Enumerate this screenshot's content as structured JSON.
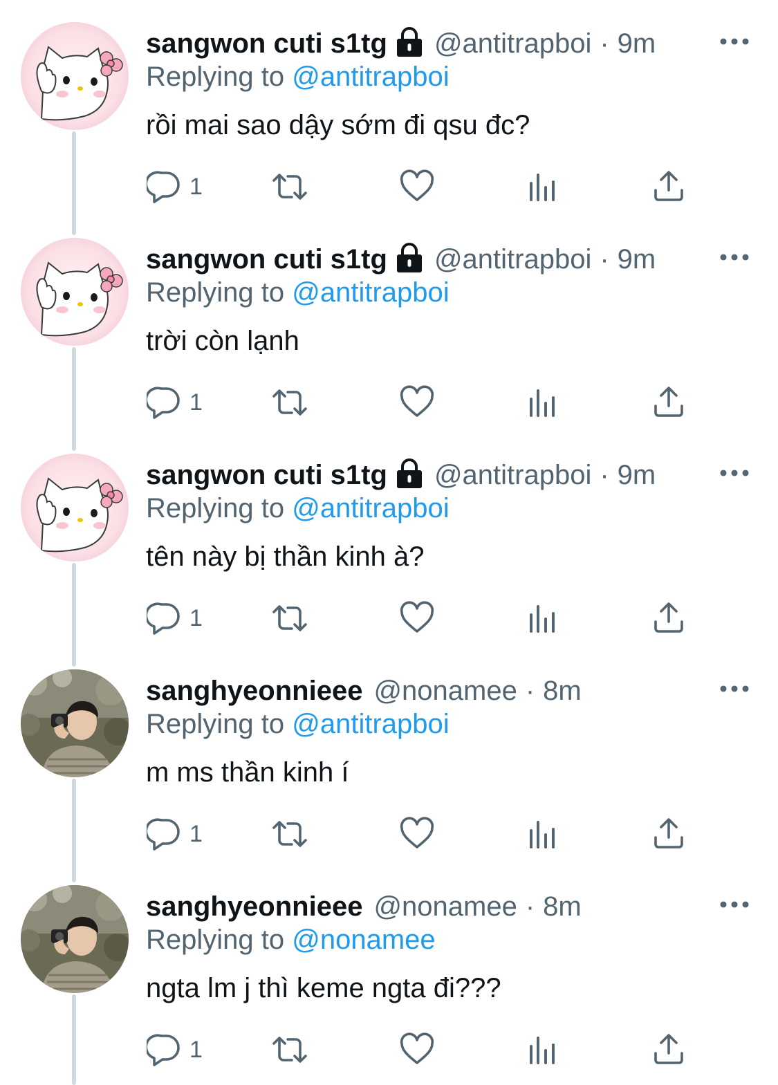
{
  "tweets": [
    {
      "display_name": "sangwon cuti s1tg",
      "locked": true,
      "handle": "@antitrapboi",
      "separator": "·",
      "time": "9m",
      "reply_prefix": "Replying to",
      "reply_to": "@antitrapboi",
      "text": "rồi mai sao dậy sớm đi qsu đc?",
      "reply_count": "1",
      "avatar": "hello-kitty-avatar"
    },
    {
      "display_name": "sangwon cuti s1tg",
      "locked": true,
      "handle": "@antitrapboi",
      "separator": "·",
      "time": "9m",
      "reply_prefix": "Replying to",
      "reply_to": "@antitrapboi",
      "text": "trời còn lạnh",
      "reply_count": "1",
      "avatar": "hello-kitty-avatar"
    },
    {
      "display_name": "sangwon cuti s1tg",
      "locked": true,
      "handle": "@antitrapboi",
      "separator": "·",
      "time": "9m",
      "reply_prefix": "Replying to",
      "reply_to": "@antitrapboi",
      "text": "tên này bị thần kinh à?",
      "reply_count": "1",
      "avatar": "hello-kitty-avatar"
    },
    {
      "display_name": "sanghyeonnieee",
      "locked": false,
      "handle": "@nonamee",
      "separator": "·",
      "time": "8m",
      "reply_prefix": "Replying to",
      "reply_to": "@antitrapboi",
      "text": "m ms thần kinh í",
      "reply_count": "1",
      "avatar": "person-photo-avatar"
    },
    {
      "display_name": "sanghyeonnieee",
      "locked": false,
      "handle": "@nonamee",
      "separator": "·",
      "time": "8m",
      "reply_prefix": "Replying to",
      "reply_to": "@nonamee",
      "text": "ngta lm j thì keme ngta đi???",
      "reply_count": "1",
      "avatar": "person-photo-avatar"
    }
  ],
  "icons": {
    "reply": "comment-icon",
    "retweet": "retweet-icon",
    "like": "heart-icon",
    "views": "analytics-icon",
    "share": "share-icon",
    "more": "more-options-icon",
    "lock": "lock-icon"
  },
  "colors": {
    "text_primary": "#0f1419",
    "text_secondary": "#536471",
    "link": "#1d9bf0",
    "thread_line": "#cfd9de"
  }
}
